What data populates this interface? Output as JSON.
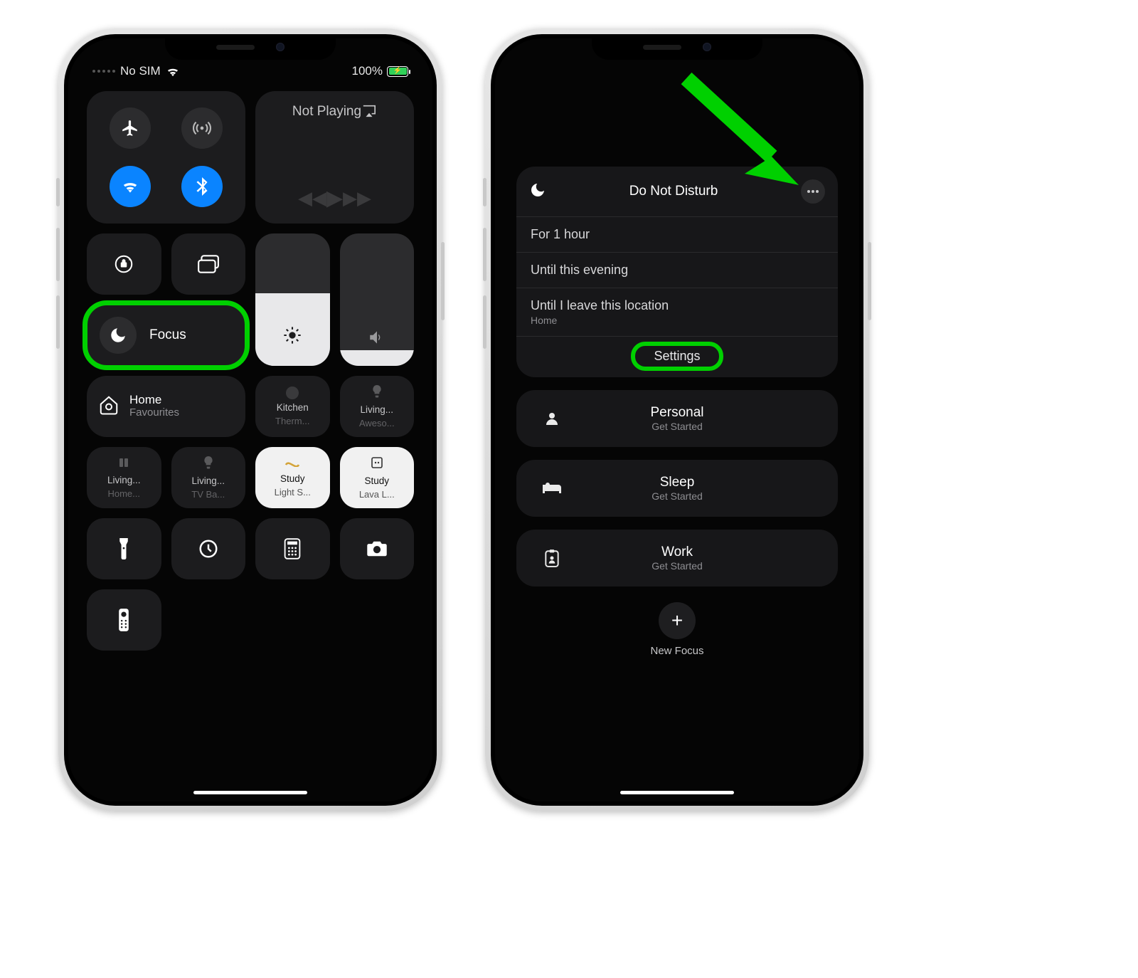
{
  "status": {
    "carrier": "No SIM",
    "battery_pct": "100%"
  },
  "controlCenter": {
    "media_label": "Not Playing",
    "focus_label": "Focus",
    "home": {
      "title": "Home",
      "subtitle": "Favourites"
    },
    "homeTiles": [
      {
        "title": "Kitchen",
        "subtitle": "Therm..."
      },
      {
        "title": "Living...",
        "subtitle": "Aweso..."
      },
      {
        "title": "Living...",
        "subtitle": "Home..."
      },
      {
        "title": "Living...",
        "subtitle": "TV Ba..."
      },
      {
        "title": "Study",
        "subtitle": "Light S..."
      },
      {
        "title": "Study",
        "subtitle": "Lava L..."
      }
    ]
  },
  "focusDetail": {
    "dnd": {
      "title": "Do Not Disturb",
      "options": [
        {
          "label": "For 1 hour"
        },
        {
          "label": "Until this evening"
        },
        {
          "label": "Until I leave this location",
          "sub": "Home"
        }
      ],
      "settings_label": "Settings"
    },
    "modes": [
      {
        "name": "Personal",
        "sub": "Get Started",
        "icon": "person"
      },
      {
        "name": "Sleep",
        "sub": "Get Started",
        "icon": "bed"
      },
      {
        "name": "Work",
        "sub": "Get Started",
        "icon": "badge"
      }
    ],
    "new_label": "New Focus"
  }
}
